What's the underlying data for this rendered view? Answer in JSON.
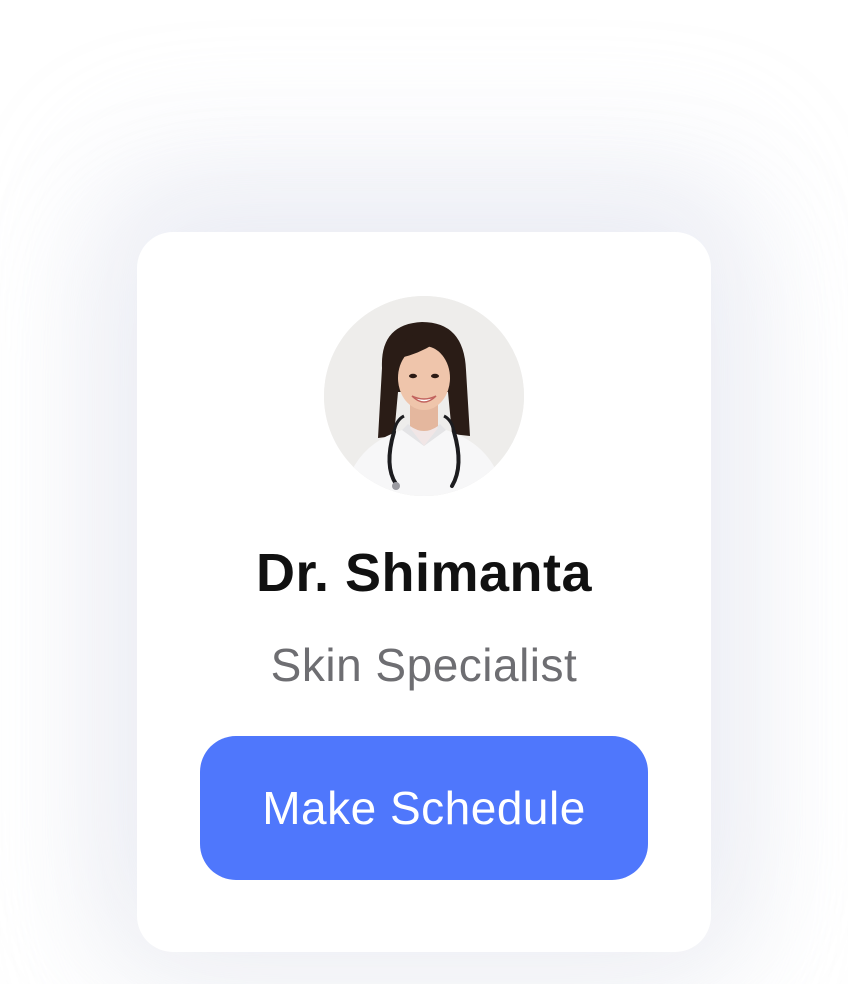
{
  "doctor": {
    "name": "Dr. Shimanta",
    "specialty": "Skin Specialist",
    "avatar_icon": "doctor-portrait"
  },
  "actions": {
    "schedule_label": "Make Schedule"
  },
  "colors": {
    "accent": "#4F77FC",
    "name_text": "#111111",
    "specialty_text": "#6E6E72",
    "card_background": "#FFFFFF"
  }
}
